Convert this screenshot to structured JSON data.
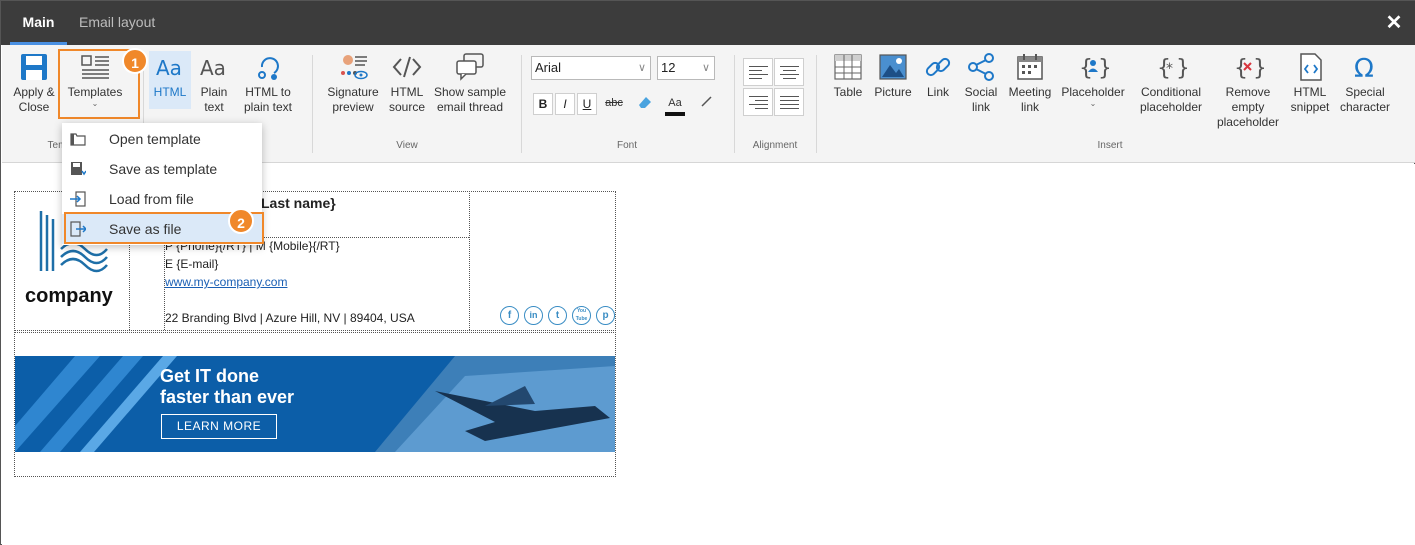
{
  "tabs": [
    {
      "label": "Main",
      "active": true
    },
    {
      "label": "Email layout",
      "active": false
    }
  ],
  "close_symbol": "✕",
  "ribbon": {
    "apply_close": "Apply & Close",
    "templates": "Templates",
    "html": "HTML",
    "plain_text": "Plain text",
    "html_to_plain": "HTML to plain text",
    "signature_preview": "Signature preview",
    "html_source": "HTML source",
    "show_sample": "Show sample email thread",
    "font_name": "Arial",
    "font_size": "12",
    "bold": "B",
    "italic": "I",
    "underline": "U",
    "strike": "abc",
    "font_color": "Aa",
    "table": "Table",
    "picture": "Picture",
    "link": "Link",
    "social_link": "Social link",
    "meeting_link": "Meeting link",
    "placeholder": "Placeholder",
    "conditional_placeholder": "Conditional placeholder",
    "remove_empty_placeholder": "Remove empty placeholder",
    "html_snippet": "HTML snippet",
    "special_character": "Special character",
    "groups": {
      "templates": "Tem",
      "view": "View",
      "font": "Font",
      "alignment": "Alignment",
      "insert": "Insert"
    }
  },
  "callouts": [
    "1",
    "2"
  ],
  "menu": {
    "items": [
      {
        "label": "Open template",
        "icon": "folder-icon"
      },
      {
        "label": "Save as template",
        "icon": "save-template-icon"
      },
      {
        "label": "Load from file",
        "icon": "load-file-icon"
      },
      {
        "label": "Save as file",
        "icon": "save-file-icon",
        "selected": true
      }
    ]
  },
  "signature": {
    "name": "Last name}",
    "phone_line": "P {Phone}{/RT} | M {Mobile}{/RT}",
    "email_line": "E {E-mail}",
    "website": "www.my-company.com",
    "address": "22 Branding Blvd | Azure Hill, NV | 89404, USA",
    "company": "company",
    "social": [
      "f",
      "in",
      "t",
      "You Tube",
      "p"
    ]
  },
  "banner": {
    "line1": "Get IT done",
    "line2": "faster than ever",
    "button": "LEARN MORE"
  },
  "colors": {
    "accent_orange": "#f0882a",
    "tab_bar": "#3c3c3c",
    "selected_bg": "#dbe9f8",
    "brand_blue": "#0c5ea8"
  }
}
